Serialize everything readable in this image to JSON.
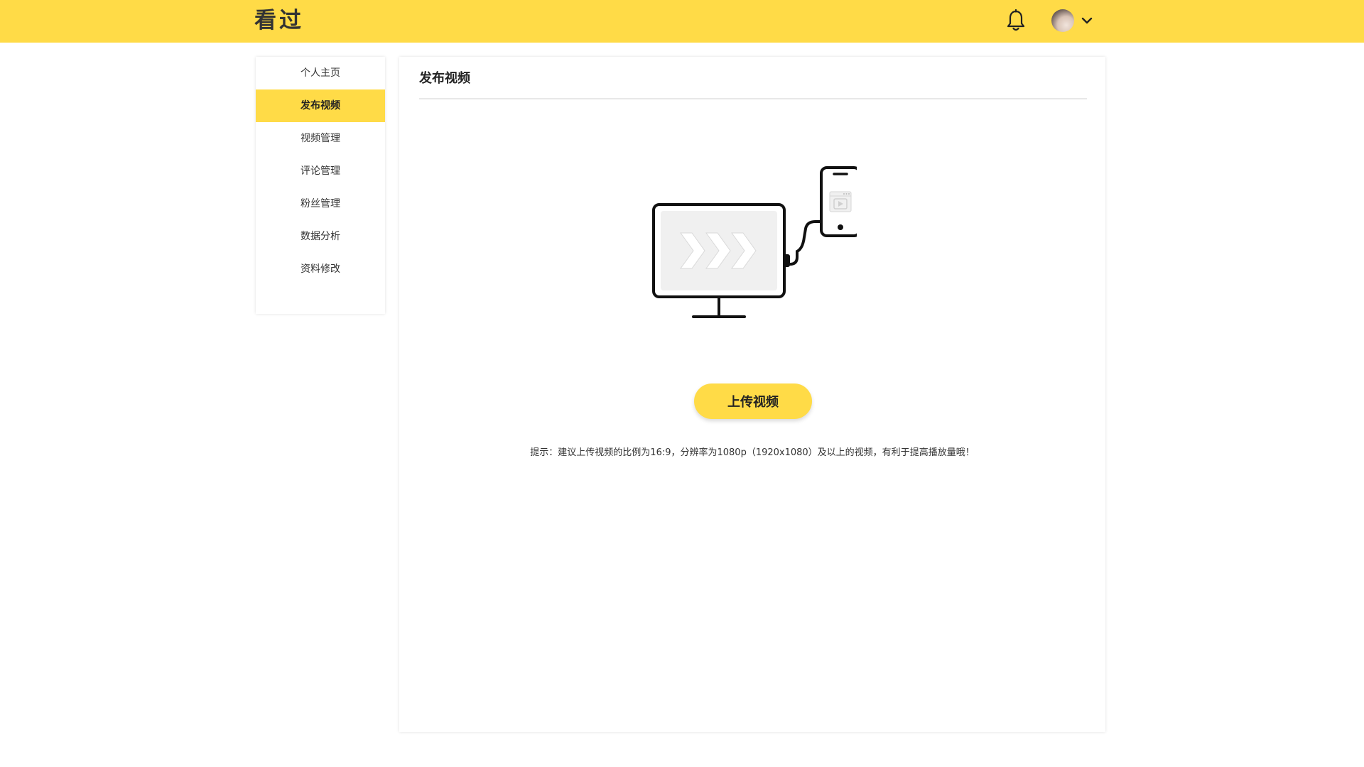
{
  "header": {
    "logo": "看过",
    "accent_color": "#FFDB47",
    "icons": {
      "notification": "bell-icon",
      "avatar": "user-avatar",
      "dropdown": "chevron-down-icon"
    }
  },
  "sidebar": {
    "items": [
      {
        "label": "个人主页",
        "active": false
      },
      {
        "label": "发布视频",
        "active": true
      },
      {
        "label": "视频管理",
        "active": false
      },
      {
        "label": "评论管理",
        "active": false
      },
      {
        "label": "粉丝管理",
        "active": false
      },
      {
        "label": "数据分析",
        "active": false
      },
      {
        "label": "资料修改",
        "active": false
      }
    ]
  },
  "main": {
    "title": "发布视频",
    "illustration": "monitor-phone-upload-illustration",
    "upload_button": "上传视频",
    "hint": "提示：建议上传视频的比例为16:9，分辨率为1080p（1920x1080）及以上的视频，有利于提高播放量哦！"
  }
}
